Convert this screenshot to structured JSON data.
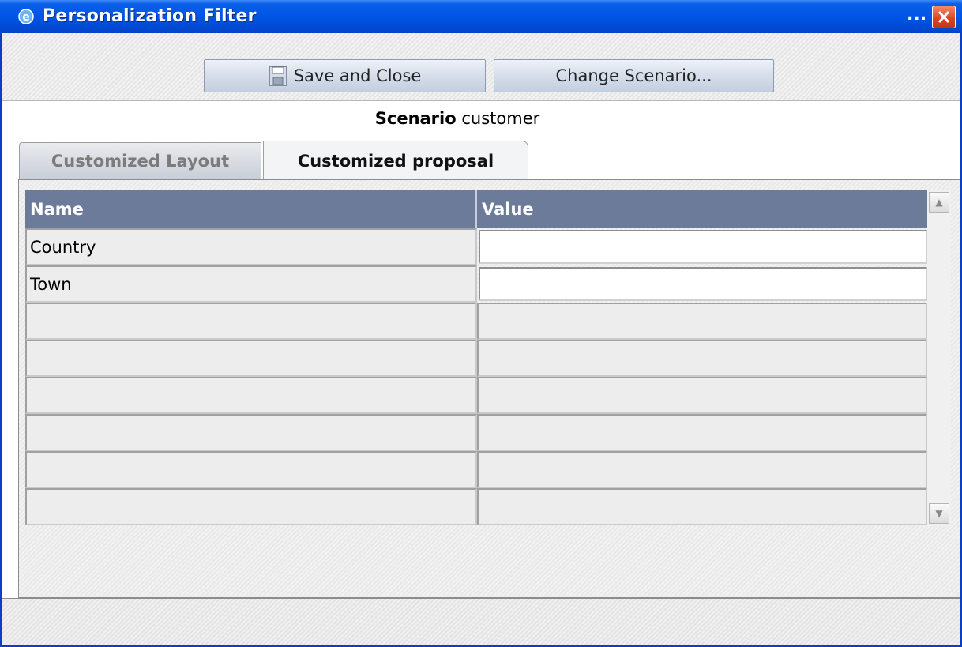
{
  "window": {
    "title": "Personalization Filter",
    "overflow_dots": "...",
    "title_icon": "ie-icon",
    "close_icon": "close-icon"
  },
  "toolbar": {
    "save_label": "Save and Close",
    "save_icon": "floppy-disk-icon",
    "change_label": "Change Scenario..."
  },
  "scenario": {
    "label": "Scenario",
    "value": "customer"
  },
  "tabs": [
    {
      "label": "Customized Layout",
      "active": false
    },
    {
      "label": "Customized proposal",
      "active": true
    }
  ],
  "grid": {
    "columns": [
      "Name",
      "Value"
    ],
    "rows": [
      {
        "name": "Country",
        "value": ""
      },
      {
        "name": "Town",
        "value": ""
      },
      {
        "name": "",
        "value": ""
      },
      {
        "name": "",
        "value": ""
      },
      {
        "name": "",
        "value": ""
      },
      {
        "name": "",
        "value": ""
      },
      {
        "name": "",
        "value": ""
      },
      {
        "name": "",
        "value": ""
      }
    ]
  },
  "colors": {
    "titlebar": "#0055e5",
    "grid_header": "#6c7b99",
    "close_button": "#d9431e"
  }
}
